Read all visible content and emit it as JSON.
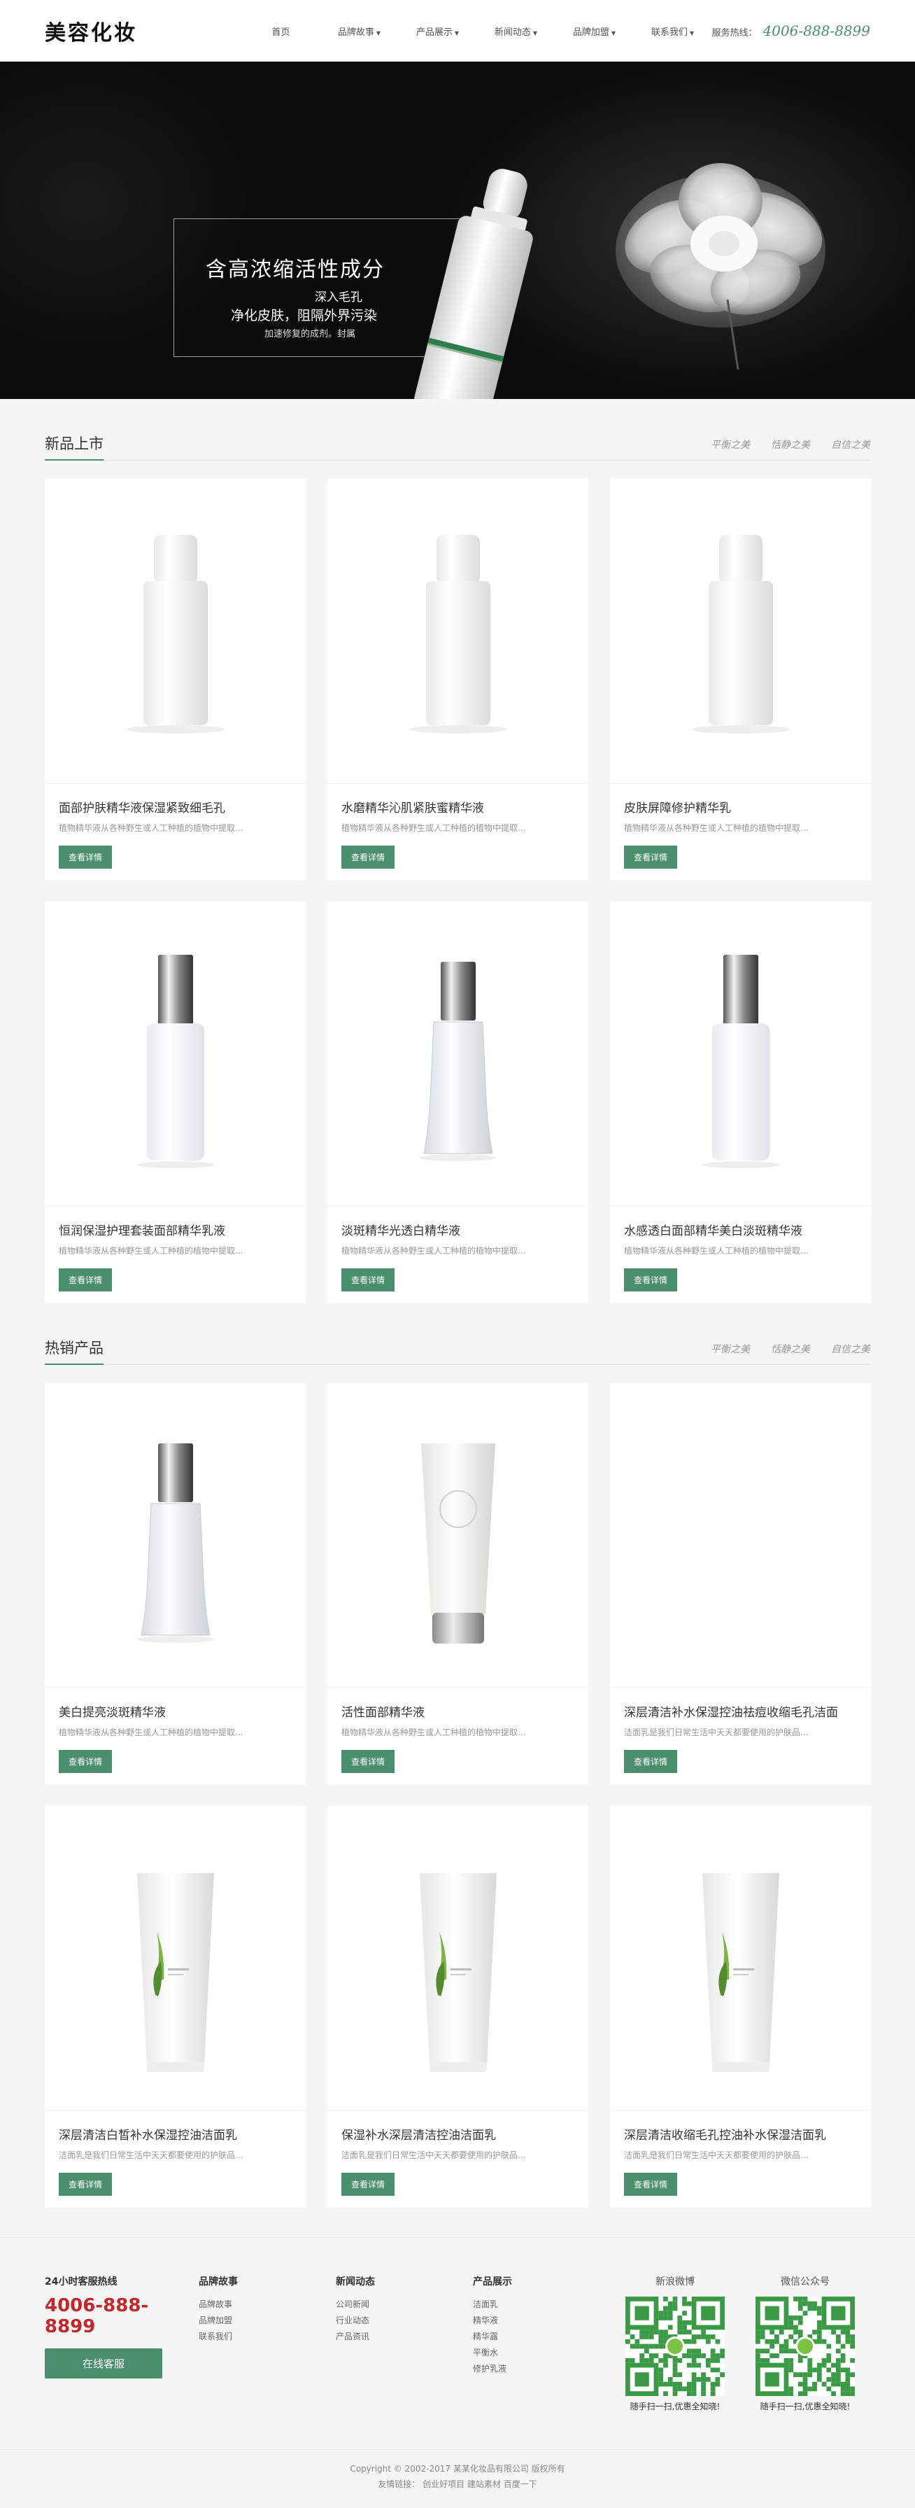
{
  "header": {
    "logo": "美容化妆",
    "nav": [
      {
        "label": "首页",
        "dropdown": false
      },
      {
        "label": "品牌故事",
        "dropdown": true
      },
      {
        "label": "产品展示",
        "dropdown": true
      },
      {
        "label": "新闻动态",
        "dropdown": true
      },
      {
        "label": "品牌加盟",
        "dropdown": true
      },
      {
        "label": "联系我们",
        "dropdown": true
      }
    ],
    "hotline_label": "服务热线：",
    "hotline_number": "4006-888-8899"
  },
  "banner": {
    "title": "含高浓缩活性成分",
    "line2": "深入毛孔",
    "line3": "净化皮肤，阻隔外界污染",
    "line4": "加速修复的成剂。封属"
  },
  "sections": [
    {
      "title": "新品上市",
      "tags": [
        "平衡之美",
        "恬静之美",
        "自信之美"
      ],
      "products": [
        {
          "title": "面部护肤精华液保湿紧致细毛孔",
          "desc": "植物精华液从各种野生或人工种植的植物中提取...",
          "button": "查看详情",
          "img": "matte-bottle"
        },
        {
          "title": "水磨精华沁肌紧肤蜜精华液",
          "desc": "植物精华液从各种野生或人工种植的植物中提取...",
          "button": "查看详情",
          "img": "matte-bottle"
        },
        {
          "title": "皮肤屏障修护精华乳",
          "desc": "植物精华液从各种野生或人工种植的植物中提取...",
          "button": "查看详情",
          "img": "matte-bottle"
        },
        {
          "title": "恒润保湿护理套装面部精华乳液",
          "desc": "植物精华液从各种野生或人工种植的植物中提取...",
          "button": "查看详情",
          "img": "silver-bottle"
        },
        {
          "title": "淡斑精华光透白精华液",
          "desc": "植物精华液从各种野生或人工种植的植物中提取...",
          "button": "查看详情",
          "img": "glass-bottle"
        },
        {
          "title": "水感透白面部精华美白淡斑精华液",
          "desc": "植物精华液从各种野生或人工种植的植物中提取...",
          "button": "查看详情",
          "img": "silver-bottle"
        }
      ]
    },
    {
      "title": "热销产品",
      "tags": [
        "平衡之美",
        "恬静之美",
        "自信之美"
      ],
      "products": [
        {
          "title": "美白提亮淡斑精华液",
          "desc": "植物精华液从各种野生或人工种植的植物中提取...",
          "button": "查看详情",
          "img": "glass-bottle"
        },
        {
          "title": "活性面部精华液",
          "desc": "植物精华液从各种野生或人工种植的植物中提取...",
          "button": "查看详情",
          "img": "tube-flower"
        },
        {
          "title": "深层清洁补水保湿控油祛痘收缩毛孔洁面",
          "desc": "洁面乳是我们日常生活中天天都要使用的护肤品...",
          "button": "查看详情",
          "img": "none"
        },
        {
          "title": "深层清洁白皙补水保湿控油洁面乳",
          "desc": "洁面乳是我们日常生活中天天都要使用的护肤品...",
          "button": "查看详情",
          "img": "tube-leaf"
        },
        {
          "title": "保湿补水深层清洁控油洁面乳",
          "desc": "洁面乳是我们日常生活中天天都要使用的护肤品...",
          "button": "查看详情",
          "img": "tube-leaf"
        },
        {
          "title": "深层清洁收缩毛孔控油补水保湿洁面乳",
          "desc": "洁面乳是我们日常生活中天天都要使用的护肤品...",
          "button": "查看详情",
          "img": "tube-leaf"
        }
      ]
    }
  ],
  "footer": {
    "hotline_label": "24小时客服热线",
    "hotline_number": "4006-888-8899",
    "chat_button": "在线客服",
    "columns": [
      {
        "title": "品牌故事",
        "links": [
          "品牌故事",
          "品牌加盟",
          "联系我们"
        ]
      },
      {
        "title": "新闻动态",
        "links": [
          "公司新闻",
          "行业动态",
          "产品资讯"
        ]
      },
      {
        "title": "产品展示",
        "links": [
          "洁面乳",
          "精华液",
          "精华露",
          "平衡水",
          "修护乳液"
        ]
      }
    ],
    "qr": [
      {
        "title": "新浪微博",
        "caption": "随手扫一扫,优惠全知晓!"
      },
      {
        "title": "微信公众号",
        "caption": "随手扫一扫,优惠全知晓!"
      }
    ],
    "copyright": "Copyright © 2002-2017 某某化妆品有限公司 版权所有",
    "friend_links": "友情链接： 创业好项目 建站素材 百度一下"
  },
  "colors": {
    "accent": "#4a8f6d",
    "hotline_red": "#c4262b"
  }
}
